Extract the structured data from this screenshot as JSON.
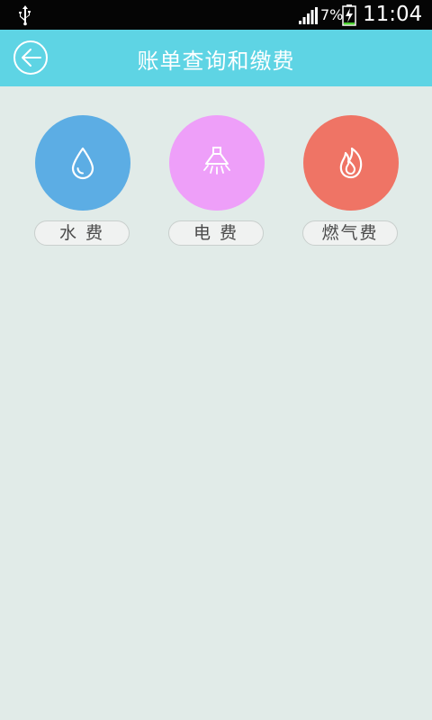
{
  "status_bar": {
    "battery_percent": "7%",
    "time": "11:04"
  },
  "header": {
    "title": "账单查询和缴费"
  },
  "services": [
    {
      "label": "水 费",
      "icon": "water-drop-icon",
      "color": "#5cade4"
    },
    {
      "label": "电 费",
      "icon": "lamp-icon",
      "color": "#ee9ff9"
    },
    {
      "label": "燃气费",
      "icon": "flame-icon",
      "color": "#ef7465"
    }
  ]
}
